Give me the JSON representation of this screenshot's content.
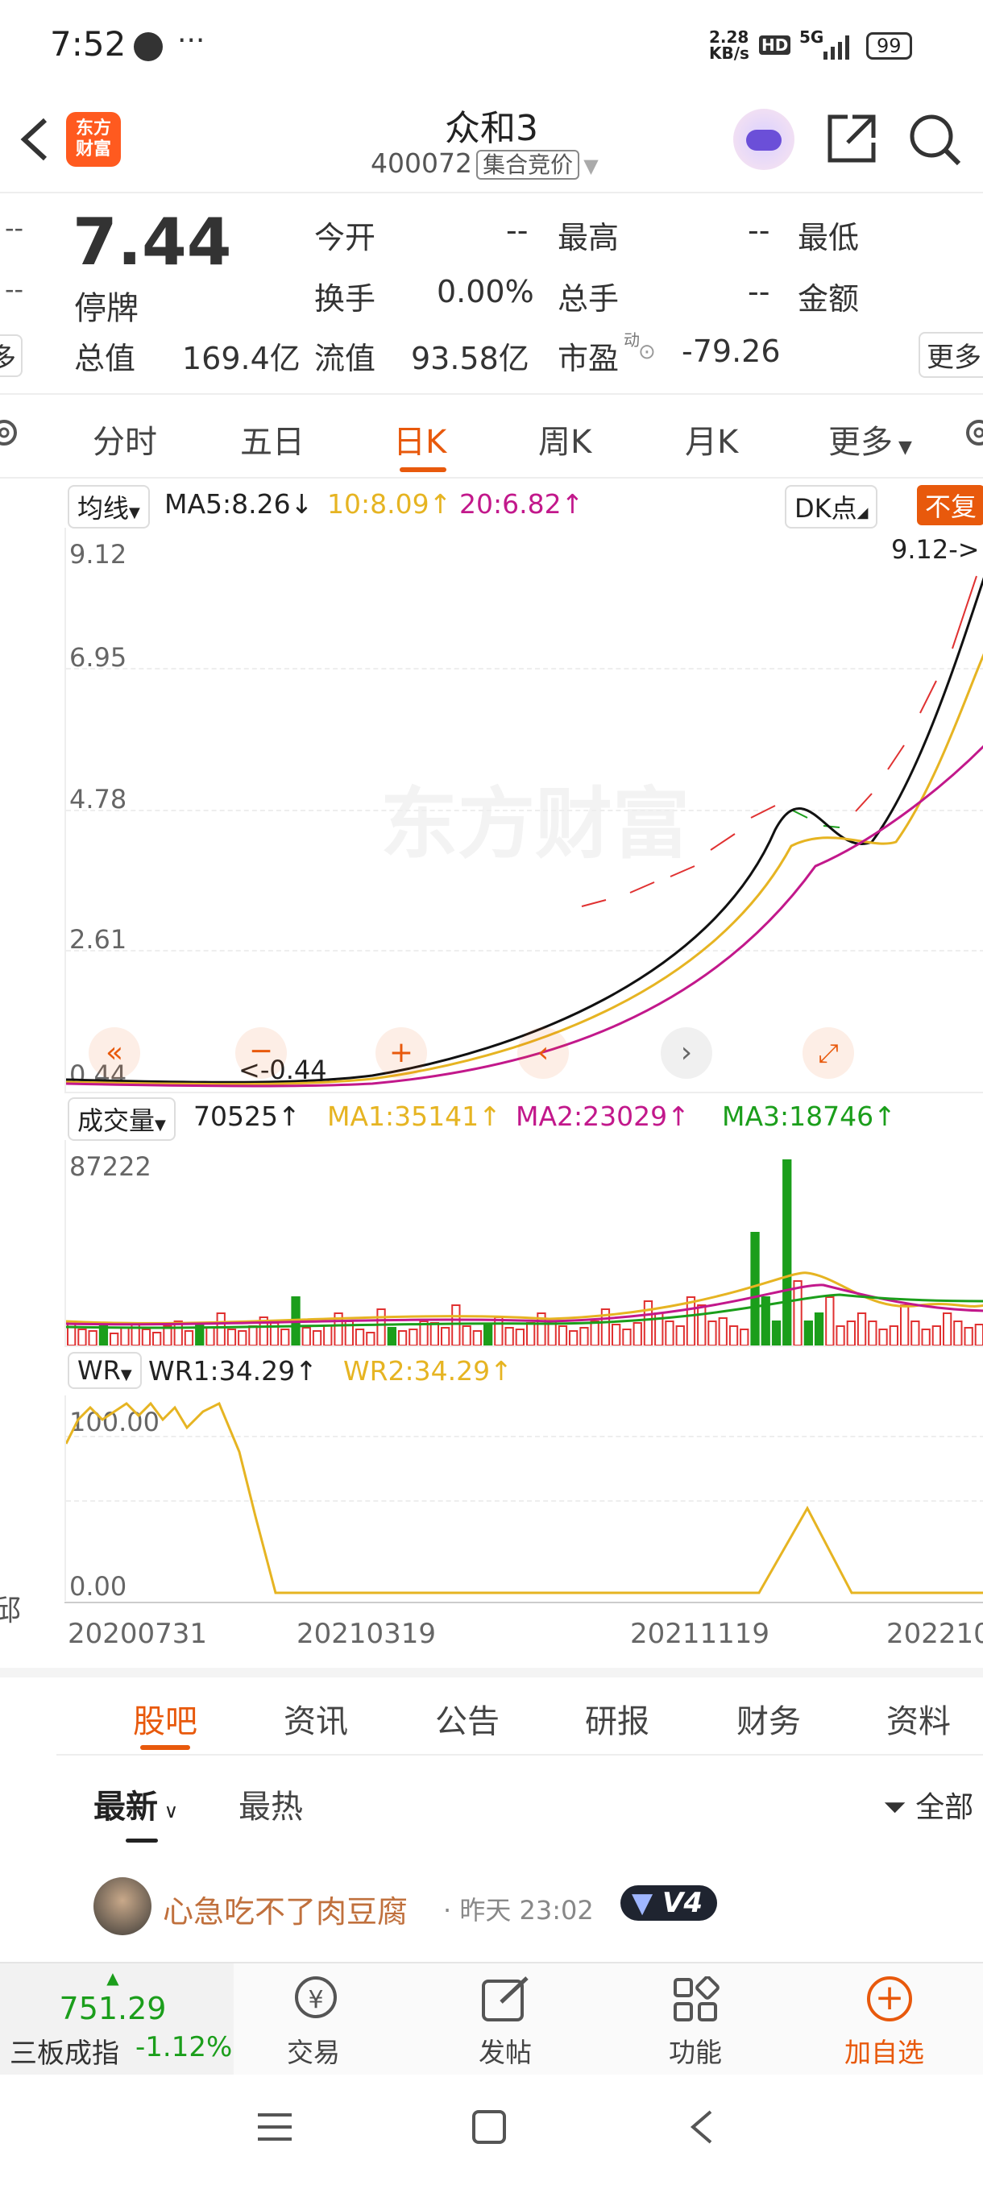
{
  "status_bar": {
    "time": "7:52",
    "extra": "···",
    "speed_top": "2.28",
    "speed_bottom": "KB/s",
    "hd": "HD",
    "net": "5G",
    "battery": "99"
  },
  "header": {
    "brand_line1": "东方",
    "brand_line2": "财富",
    "stock_name": "众和3",
    "code": "400072",
    "tag": "集合竞价"
  },
  "quote": {
    "price": "7.44",
    "status": "停牌",
    "left_dashes": [
      "--",
      "--"
    ],
    "left_edge": "多",
    "open_label": "今开",
    "open_value": "--",
    "high_label": "最高",
    "high_value": "--",
    "low_label": "最低",
    "turnover_label": "换手",
    "turnover_value": "0.00%",
    "total_hands_label": "总手",
    "total_hands_value": "--",
    "amount_label": "金额",
    "total_value_label": "总值",
    "total_value": "169.4亿",
    "float_value_label": "流值",
    "float_value": "93.58亿",
    "pe_label": "市盈",
    "pe_dyn": "动",
    "pe_value": "-79.26",
    "more": "更多"
  },
  "period_tabs": [
    "分时",
    "五日",
    "日K",
    "周K",
    "月K",
    "更多"
  ],
  "active_tab": 2,
  "kline": {
    "ma_selector": "均线",
    "ma5": "MA5:8.26↓",
    "ma10": "10:8.09↑",
    "ma20": "20:6.82↑",
    "dk": "DK点",
    "fq": "不复",
    "price_ticks": [
      "9.12",
      "6.95",
      "4.78",
      "2.61",
      "0.44"
    ],
    "max_marker": "9.12->",
    "min_marker": "<-0.44",
    "watermark": "东方财富"
  },
  "volume": {
    "selector": "成交量",
    "value": "70525↑",
    "ma1": "MA1:35141↑",
    "ma2": "MA2:23029↑",
    "ma3": "MA3:18746↑",
    "max_tick": "87222"
  },
  "wr": {
    "selector": "WR",
    "wr1": "WR1:34.29↑",
    "wr2": "WR2:34.29↑",
    "top_tick": "100.00",
    "bottom_tick": "0.00"
  },
  "date_axis": [
    "20200731",
    "20210319",
    "20211119",
    "202210"
  ],
  "side_left": "邱",
  "content_tabs": [
    "股吧",
    "资讯",
    "公告",
    "研报",
    "财务",
    "资料"
  ],
  "sort": {
    "latest": "最新",
    "hot": "最热",
    "filter": "全部"
  },
  "post": {
    "author": "心急吃不了肉豆腐",
    "time": "· 昨天 23:02",
    "level": "V4"
  },
  "bottom_bar": {
    "index_value": "751.29",
    "index_name": "三板成指",
    "index_change": "-1.12%",
    "trade": "交易",
    "post": "发帖",
    "func": "功能",
    "add": "加自选"
  },
  "colors": {
    "accent": "#e8590c",
    "up": "#e03131",
    "down": "#1b9e1b",
    "ma10": "#e6b422",
    "ma20": "#c2188b"
  }
}
